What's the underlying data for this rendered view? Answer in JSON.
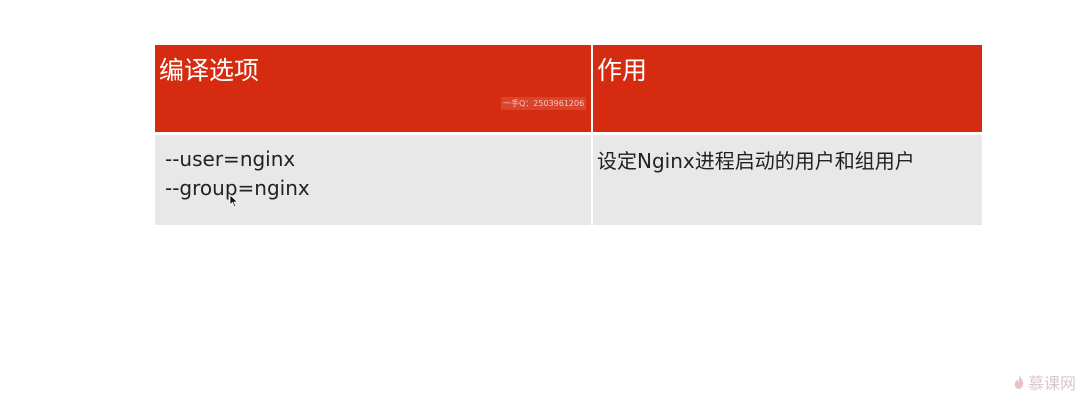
{
  "table": {
    "header": {
      "col1": "编译选项",
      "col2": "作用"
    },
    "rows": [
      {
        "options": [
          "--user=nginx",
          "--group=nginx"
        ],
        "description": "设定Nginx进程启动的用户和组用户"
      }
    ]
  },
  "watermark": {
    "qq_text": "一手Q：2503961206"
  },
  "brand": {
    "icon": "flame-icon",
    "name": "慕课网"
  },
  "colors": {
    "header_bg": "#d52b10",
    "row_bg": "#e8e8e8"
  }
}
